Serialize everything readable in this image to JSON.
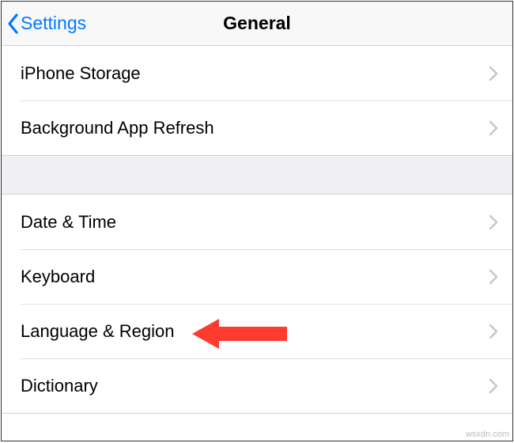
{
  "header": {
    "back_label": "Settings",
    "title": "General"
  },
  "groups": [
    {
      "rows": [
        {
          "label": "iPhone Storage"
        },
        {
          "label": "Background App Refresh"
        }
      ]
    },
    {
      "rows": [
        {
          "label": "Date & Time"
        },
        {
          "label": "Keyboard"
        },
        {
          "label": "Language & Region"
        },
        {
          "label": "Dictionary"
        }
      ]
    }
  ],
  "watermark": "wsxdn.com",
  "colors": {
    "accent": "#007aff",
    "arrow": "#ff3b30"
  }
}
